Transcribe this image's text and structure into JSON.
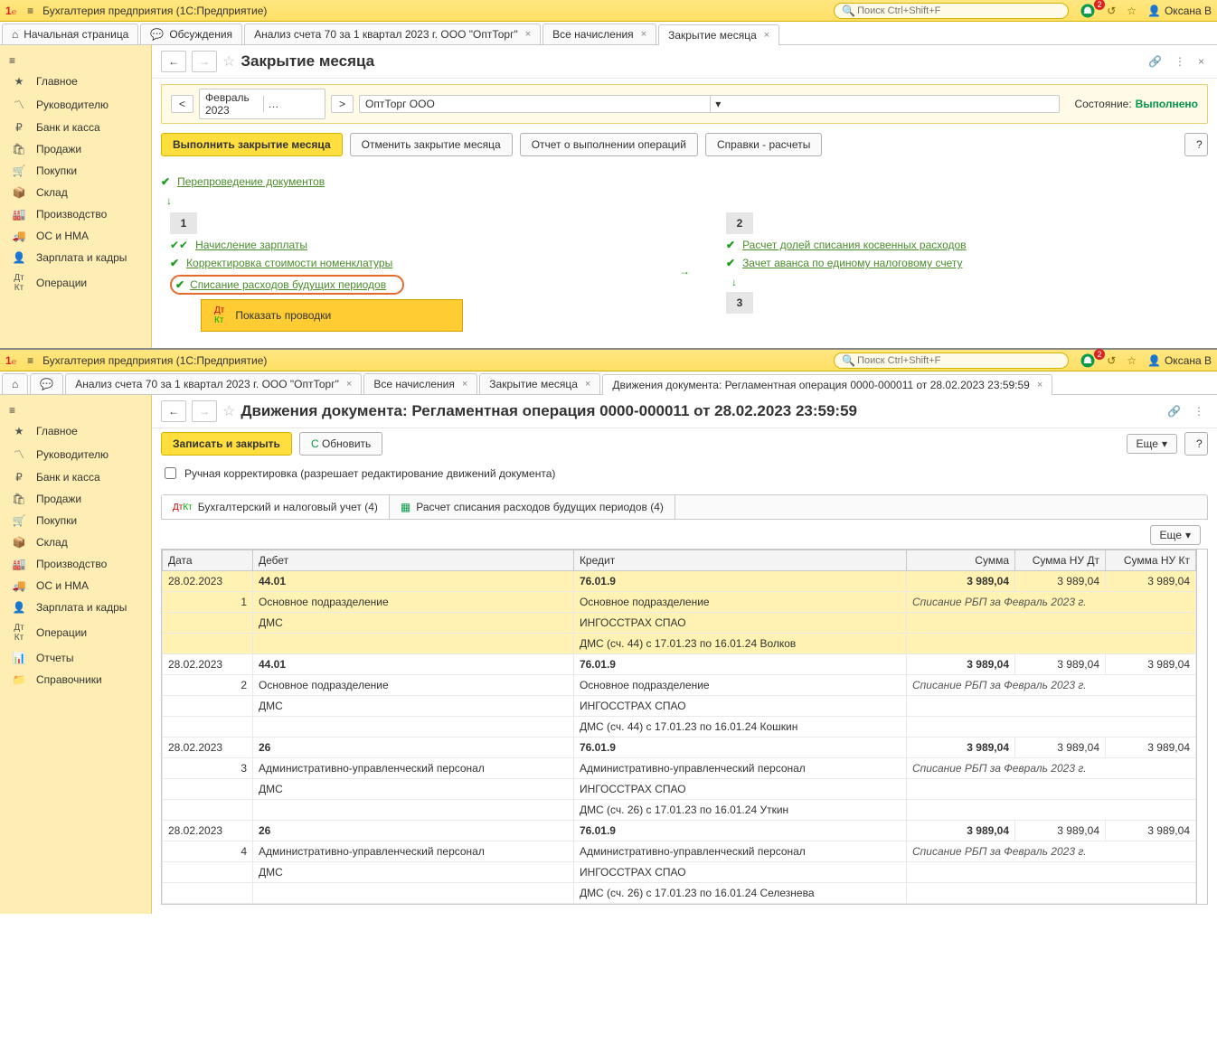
{
  "window1": {
    "topbar": {
      "app_title": "Бухгалтерия предприятия  (1C:Предприятие)",
      "search_placeholder": "Поиск Ctrl+Shift+F",
      "bell_count": "2",
      "user_name": "Оксана В"
    },
    "tabs": {
      "start": "Начальная страница",
      "discuss": "Обсуждения",
      "items": [
        {
          "label": "Анализ счета 70 за 1 квартал 2023 г. ООО \"ОптТорг\""
        },
        {
          "label": "Все начисления"
        },
        {
          "label": "Закрытие месяца"
        }
      ],
      "active_index": 2
    },
    "sidebar": [
      "Главное",
      "Руководителю",
      "Банк и касса",
      "Продажи",
      "Покупки",
      "Склад",
      "Производство",
      "ОС и НМА",
      "Зарплата и кадры",
      "Операции"
    ],
    "page": {
      "title": "Закрытие месяца",
      "period": "Февраль 2023",
      "org": "ОптТорг ООО",
      "state_label": "Состояние:",
      "state_value": "Выполнено",
      "buttons": {
        "execute": "Выполнить закрытие месяца",
        "cancel": "Отменить закрытие месяца",
        "report": "Отчет о выполнении операций",
        "refs": "Справки - расчеты"
      },
      "tree": {
        "repost": "Перепроведение документов",
        "c1": {
          "l1": "Начисление зарплаты",
          "l2": "Корректировка стоимости номенклатуры",
          "l3": "Списание расходов будущих периодов"
        },
        "c2": {
          "l1": "Расчет долей списания косвенных расходов",
          "l2": "Зачет аванса по единому налоговому счету"
        },
        "ctx_label": "Показать проводки"
      }
    }
  },
  "window2": {
    "topbar": {
      "app_title": "Бухгалтерия предприятия  (1C:Предприятие)",
      "search_placeholder": "Поиск Ctrl+Shift+F",
      "bell_count": "2",
      "user_name": "Оксана В"
    },
    "tabs": {
      "items": [
        {
          "label": "Анализ счета 70 за 1 квартал 2023 г. ООО \"ОптТорг\""
        },
        {
          "label": "Все начисления"
        },
        {
          "label": "Закрытие месяца"
        },
        {
          "label": "Движения документа: Регламентная операция 0000-000011 от 28.02.2023 23:59:59"
        }
      ],
      "active_index": 3
    },
    "sidebar": [
      "Главное",
      "Руководителю",
      "Банк и касса",
      "Продажи",
      "Покупки",
      "Склад",
      "Производство",
      "ОС и НМА",
      "Зарплата и кадры",
      "Операции",
      "Отчеты",
      "Справочники"
    ],
    "page": {
      "title": "Движения документа: Регламентная операция 0000-000011 от 28.02.2023 23:59:59",
      "save": "Записать и закрыть",
      "refresh": "Обновить",
      "more": "Еще",
      "manual_cb": "Ручная корректировка (разрешает редактирование движений документа)",
      "acct_tabs": {
        "t1": "Бухгалтерский и налоговый учет (4)",
        "t2": "Расчет списания расходов будущих периодов (4)"
      }
    },
    "table": {
      "headers": {
        "date": "Дата",
        "debit": "Дебет",
        "credit": "Кредит",
        "sum": "Сумма",
        "nud": "Сумма НУ Дт",
        "nuk": "Сумма НУ Кт"
      },
      "rows": [
        {
          "date": "28.02.2023",
          "n": "1",
          "d_acc": "44.01",
          "c_acc": "76.01.9",
          "sum": "3 989,04",
          "nud": "3 989,04",
          "nuk": "3 989,04",
          "d_sub1": "Основное подразделение",
          "c_sub1": "Основное подразделение",
          "note": "Списание РБП за Февраль 2023 г.",
          "d_sub2": "ДМС",
          "c_sub2": "ИНГОССТРАХ СПАО",
          "c_sub3": "ДМС (сч. 44) с 17.01.23 по 16.01.24 Волков",
          "hl": true
        },
        {
          "date": "28.02.2023",
          "n": "2",
          "d_acc": "44.01",
          "c_acc": "76.01.9",
          "sum": "3 989,04",
          "nud": "3 989,04",
          "nuk": "3 989,04",
          "d_sub1": "Основное подразделение",
          "c_sub1": "Основное подразделение",
          "note": "Списание РБП за Февраль 2023 г.",
          "d_sub2": "ДМС",
          "c_sub2": "ИНГОССТРАХ СПАО",
          "c_sub3": "ДМС (сч. 44) с 17.01.23 по 16.01.24 Кошкин",
          "hl": false
        },
        {
          "date": "28.02.2023",
          "n": "3",
          "d_acc": "26",
          "c_acc": "76.01.9",
          "sum": "3 989,04",
          "nud": "3 989,04",
          "nuk": "3 989,04",
          "d_sub1": "Административно-управленческий персонал",
          "c_sub1": "Административно-управленческий персонал",
          "note": "Списание РБП за Февраль 2023 г.",
          "d_sub2": "ДМС",
          "c_sub2": "ИНГОССТРАХ СПАО",
          "c_sub3": "ДМС (сч. 26) с 17.01.23 по 16.01.24 Уткин",
          "hl": false
        },
        {
          "date": "28.02.2023",
          "n": "4",
          "d_acc": "26",
          "c_acc": "76.01.9",
          "sum": "3 989,04",
          "nud": "3 989,04",
          "nuk": "3 989,04",
          "d_sub1": "Административно-управленческий персонал",
          "c_sub1": "Административно-управленческий персонал",
          "note": "Списание РБП за Февраль 2023 г.",
          "d_sub2": "ДМС",
          "c_sub2": "ИНГОССТРАХ СПАО",
          "c_sub3": "ДМС (сч. 26) с 17.01.23 по 16.01.24 Селезнева",
          "hl": false
        }
      ]
    }
  }
}
